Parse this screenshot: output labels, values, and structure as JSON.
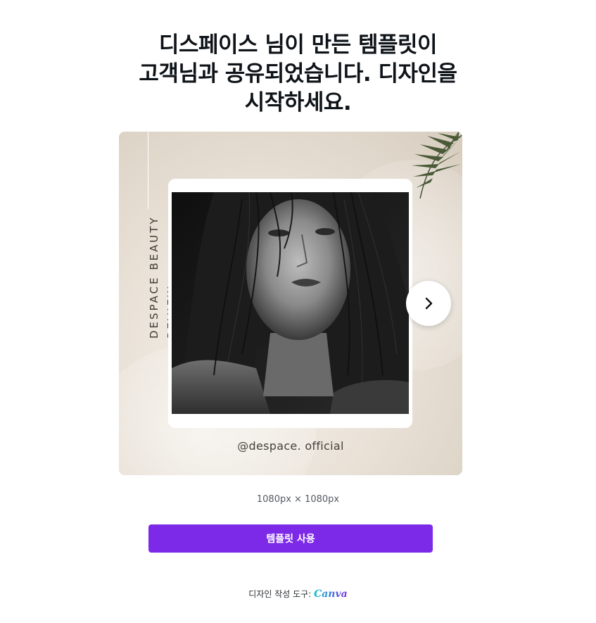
{
  "heading": {
    "line1": "디스페이스 님이 만든 템플릿이",
    "line2": "고객님과 공유되었습니다. 디자인을",
    "line3": "시작하세요."
  },
  "preview": {
    "vertical_text_line1": "DESPACE BEAUTY",
    "vertical_text_line2": "REVIEW",
    "handle": "@despace. official",
    "next_icon": "chevron-right-icon"
  },
  "dimensions": "1080px × 1080px",
  "use_template_label": "템플릿 사용",
  "footer": {
    "prefix": "디자인 작성 도구:",
    "brand": "Canva"
  },
  "colors": {
    "accent": "#7d2ae8",
    "brand_gradient_start": "#00c4cc",
    "brand_gradient_end": "#7d2ae8"
  }
}
